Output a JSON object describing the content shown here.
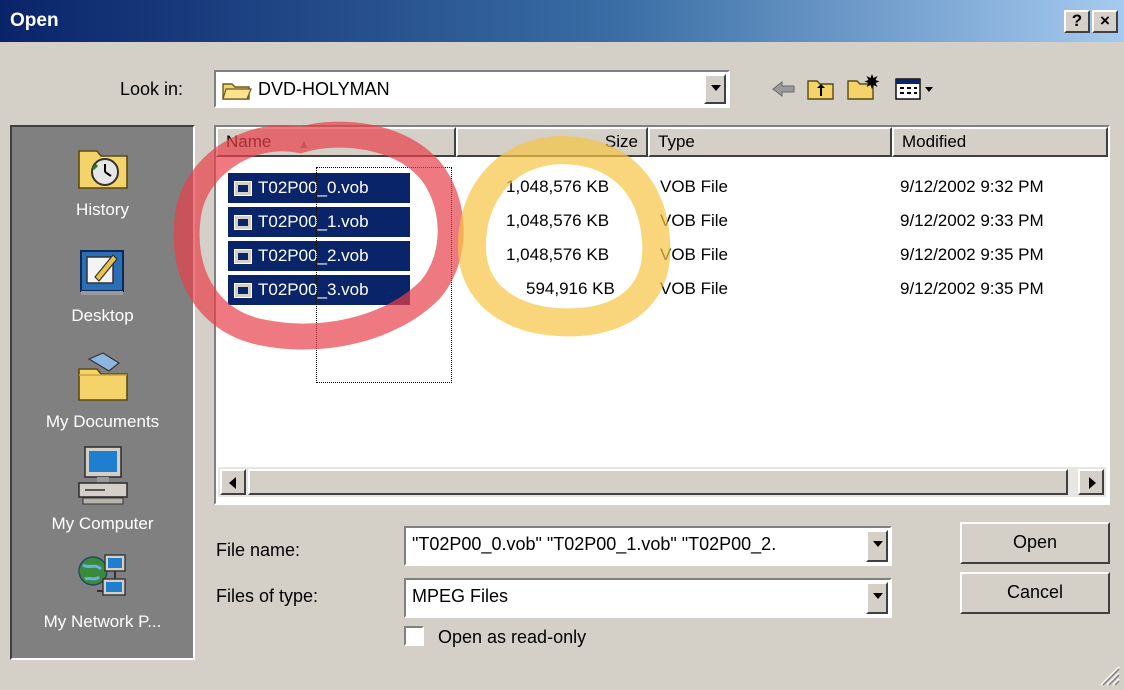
{
  "window": {
    "title": "Open",
    "help_label": "?",
    "close_label": "×"
  },
  "lookin": {
    "label": "Look in:",
    "value": "DVD-HOLYMAN"
  },
  "toolbar": {
    "icons": [
      "back-icon",
      "up-folder-icon",
      "new-folder-icon",
      "view-menu-icon"
    ]
  },
  "places": [
    {
      "label": "History",
      "icon": "history-icon"
    },
    {
      "label": "Desktop",
      "icon": "desktop-icon"
    },
    {
      "label": "My Documents",
      "icon": "my-documents-icon"
    },
    {
      "label": "My Computer",
      "icon": "my-computer-icon"
    },
    {
      "label": "My Network P...",
      "icon": "network-places-icon"
    }
  ],
  "columns": {
    "name": "Name",
    "size": "Size",
    "type": "Type",
    "modified": "Modified"
  },
  "files": [
    {
      "name": "T02P00_0.vob",
      "size": "1,048,576 KB",
      "type": "VOB File",
      "modified": "9/12/2002 9:32 PM"
    },
    {
      "name": "T02P00_1.vob",
      "size": "1,048,576 KB",
      "type": "VOB File",
      "modified": "9/12/2002 9:33 PM"
    },
    {
      "name": "T02P00_2.vob",
      "size": "1,048,576 KB",
      "type": "VOB File",
      "modified": "9/12/2002 9:35 PM"
    },
    {
      "name": "T02P00_3.vob",
      "size": "594,916 KB",
      "type": "VOB File",
      "modified": "9/12/2002 9:35 PM"
    }
  ],
  "filename": {
    "label": "File name:",
    "value": "\"T02P00_0.vob\" \"T02P00_1.vob\" \"T02P00_2."
  },
  "filetype": {
    "label": "Files of type:",
    "value": "MPEG Files"
  },
  "readonly": {
    "label": "Open as read-only",
    "checked": false
  },
  "buttons": {
    "open": "Open",
    "cancel": "Cancel"
  },
  "colors": {
    "titlebar": "#0a246a",
    "selection": "#0a246a",
    "face": "#d4d0c8",
    "annotation_red": "#e8404a",
    "annotation_yellow": "#f7c443"
  }
}
